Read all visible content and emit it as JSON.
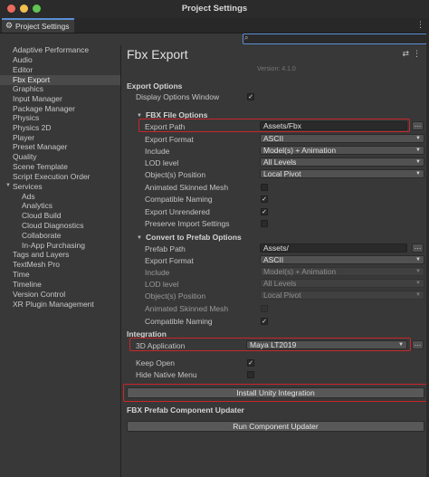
{
  "window": {
    "title": "Project Settings",
    "tab_label": "Project Settings"
  },
  "search": {
    "value": ""
  },
  "sidebar": {
    "items": [
      "Adaptive Performance",
      "Audio",
      "Editor",
      "Fbx Export",
      "Graphics",
      "Input Manager",
      "Package Manager",
      "Physics",
      "Physics 2D",
      "Player",
      "Preset Manager",
      "Quality",
      "Scene Template",
      "Script Execution Order",
      "Services",
      "Ads",
      "Analytics",
      "Cloud Build",
      "Cloud Diagnostics",
      "Collaborate",
      "In-App Purchasing",
      "Tags and Layers",
      "TextMesh Pro",
      "Time",
      "Timeline",
      "Version Control",
      "XR Plugin Management"
    ],
    "selected": "Fbx Export"
  },
  "main": {
    "title": "Fbx Export",
    "version": "Version: 4.1.0",
    "export_options": {
      "heading": "Export Options",
      "display_options_window": "Display Options Window",
      "fbx_file_options": {
        "heading": "FBX File Options",
        "export_path_label": "Export Path",
        "export_path_value": "Assets/Fbx",
        "export_format_label": "Export Format",
        "export_format_value": "ASCII",
        "include_label": "Include",
        "include_value": "Model(s) + Animation",
        "lod_label": "LOD level",
        "lod_value": "All Levels",
        "position_label": "Object(s) Position",
        "position_value": "Local Pivot",
        "animated_skinned_label": "Animated Skinned Mesh",
        "compatible_naming_label": "Compatible Naming",
        "export_unrendered_label": "Export Unrendered",
        "preserve_import_label": "Preserve Import Settings"
      },
      "convert_prefab": {
        "heading": "Convert to Prefab Options",
        "prefab_path_label": "Prefab Path",
        "prefab_path_value": "Assets/",
        "export_format_label": "Export Format",
        "export_format_value": "ASCII",
        "include_label": "Include",
        "include_value": "Model(s) + Animation",
        "lod_label": "LOD level",
        "lod_value": "All Levels",
        "position_label": "Object(s) Position",
        "position_value": "Local Pivot",
        "animated_skinned_label": "Animated Skinned Mesh",
        "compatible_naming_label": "Compatible Naming"
      }
    },
    "integration": {
      "heading": "Integration",
      "app_label": "3D Application",
      "app_value": "Maya LT2019",
      "keep_open_label": "Keep Open",
      "hide_native_label": "Hide Native Menu",
      "install_button": "Install Unity Integration"
    },
    "prefab_updater": {
      "heading": "FBX Prefab Component Updater",
      "run_button": "Run Component Updater"
    }
  },
  "icons": {
    "close": "close-circle-icon",
    "minimize": "minimize-circle-icon",
    "zoom": "zoom-circle-icon",
    "tab": "gear-icon",
    "menu": "more-menu-icon",
    "search": "search-icon",
    "preset": "preset-icon",
    "help": "help-icon",
    "dropdown": "chevron-down-icon",
    "checkmark": "checkmark-icon"
  },
  "colors": {
    "highlight": "#c8262b",
    "accent": "#5b8fd6",
    "close": "#ed6a5e",
    "minimize": "#f4bf4f",
    "zoom": "#61c554"
  }
}
